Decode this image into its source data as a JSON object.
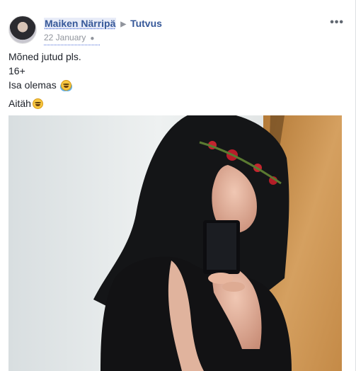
{
  "post": {
    "author": "Maiken Närripä",
    "arrow": "▶",
    "group": "Tutvus",
    "timestamp": "22 January",
    "audience_icon": "globe-icon",
    "more_icon": "ellipsis-icon",
    "lines": [
      "Mõned jutud pls.",
      "16+",
      "Isa olemas",
      "Aitäh"
    ],
    "line_emojis": [
      "",
      "",
      "laughing-tears-emoji",
      "grinning-emoji"
    ],
    "photo_icon": "selfie-photo"
  },
  "colors": {
    "link": "#365899",
    "meta": "#90949c",
    "text": "#1d2129",
    "emoji": "#f7c640"
  }
}
